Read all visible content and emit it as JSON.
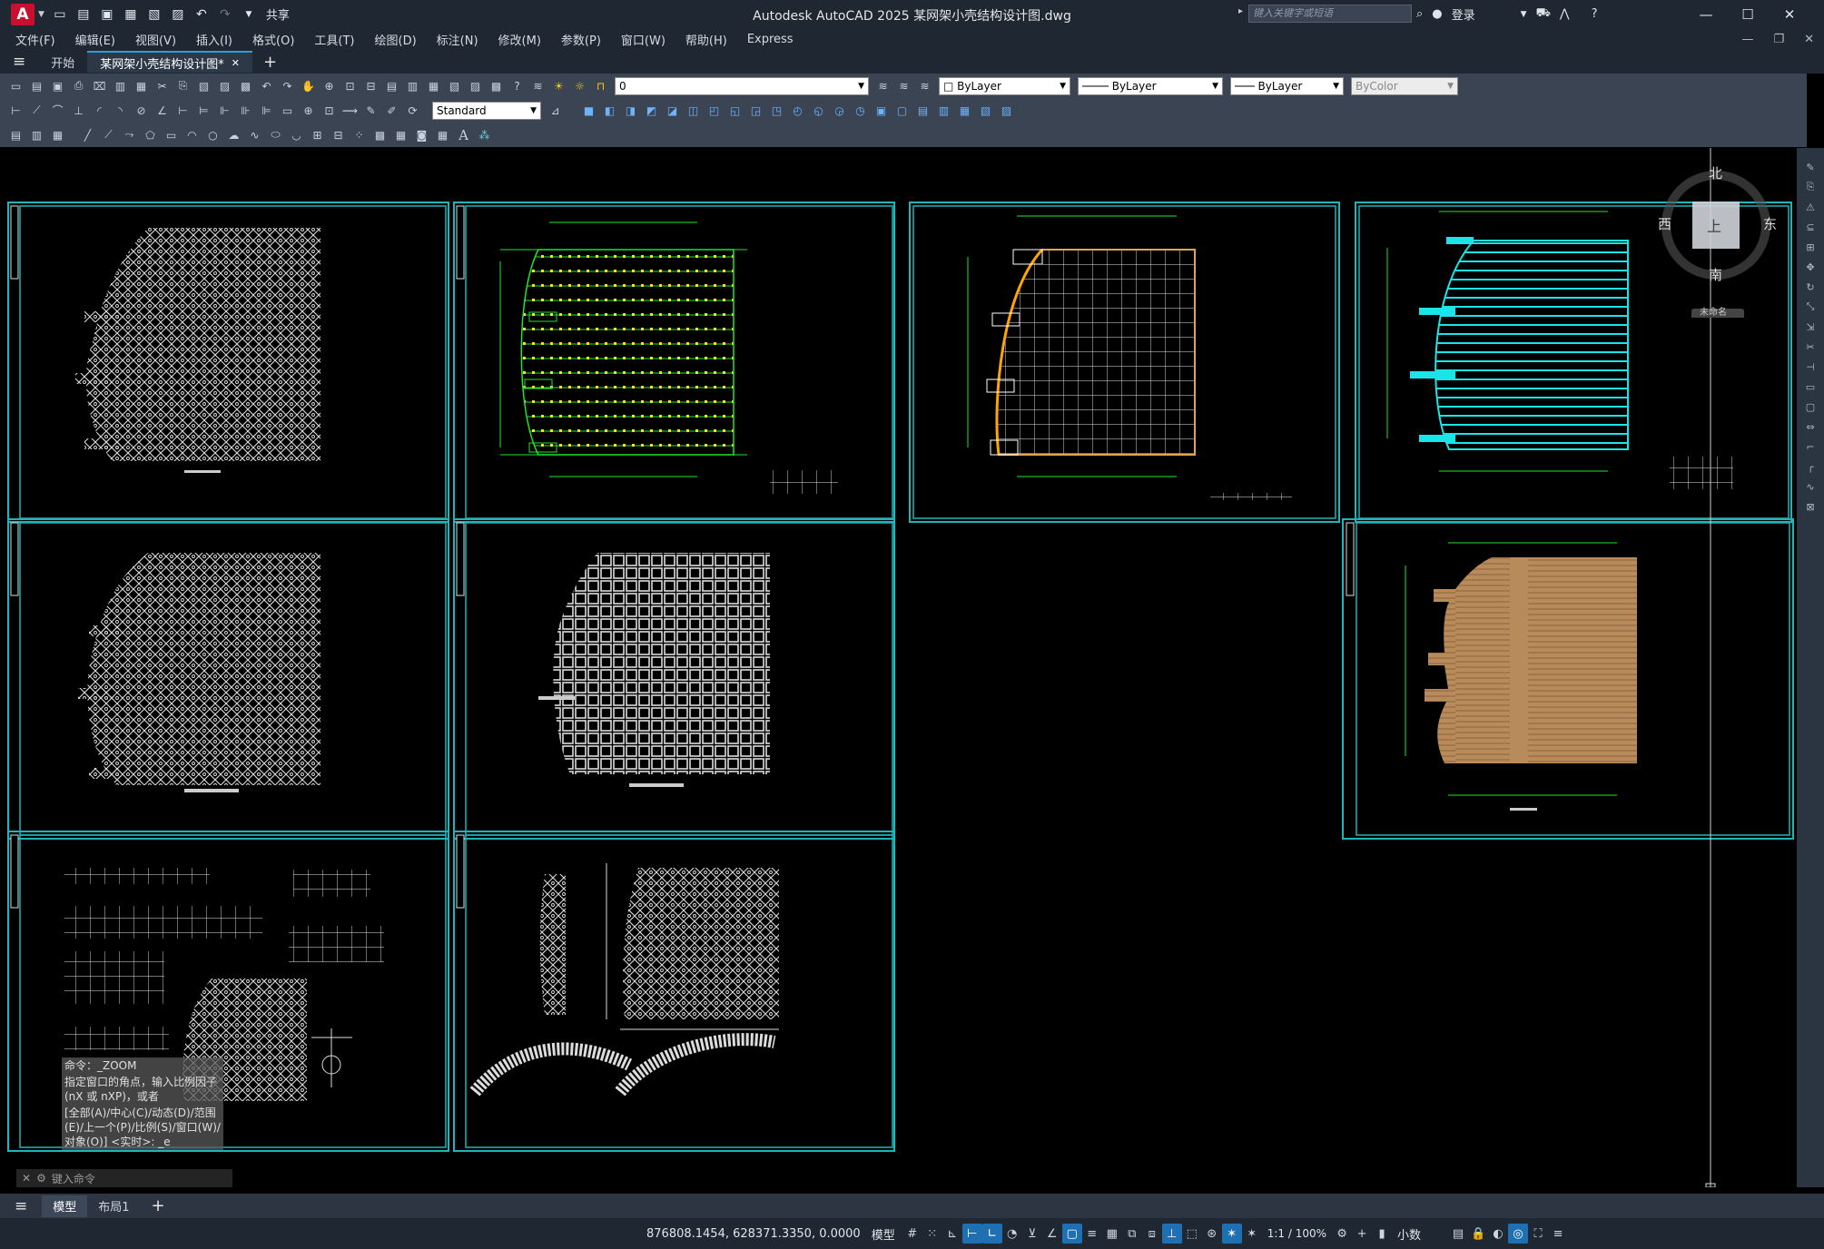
{
  "app": {
    "logo_letter": "A",
    "title": "Autodesk AutoCAD 2025    某网架小壳结构设计图.dwg",
    "share": "共享",
    "search_placeholder": "键入关键字或短语",
    "login": "登录"
  },
  "menu": [
    "文件(F)",
    "编辑(E)",
    "视图(V)",
    "插入(I)",
    "格式(O)",
    "工具(T)",
    "绘图(D)",
    "标注(N)",
    "修改(M)",
    "参数(P)",
    "窗口(W)",
    "帮助(H)",
    "Express"
  ],
  "tabs": {
    "start": "开始",
    "doc": "某网架小壳结构设计图*",
    "add": "+"
  },
  "toolbar": {
    "layer": "0",
    "color": "ByLayer",
    "linetype": "ByLayer",
    "lineweight": "ByLayer",
    "plotstyle": "ByColor",
    "textstyle": "Standard"
  },
  "viewcube": {
    "north": "北",
    "south": "南",
    "east": "东",
    "west": "西",
    "top": "上",
    "wcs": "未命名"
  },
  "command": {
    "history": [
      "命令：_ZOOM",
      "指定窗口的角点，输入比例因子 (nX 或 nXP)，或者",
      "[全部(A)/中心(C)/动态(D)/范围(E)/上一个(P)/比例(S)/窗口(W)/对象(O)] <实时>: _e"
    ],
    "prompt": "键入命令"
  },
  "layout_tabs": [
    "模型",
    "布局1"
  ],
  "status": {
    "coords": "876808.1454, 628371.3350, 0.0000",
    "model": "模型",
    "scale": "1:1 / 100%",
    "units": "小数"
  },
  "colors": {
    "frame": "#1fb5b8",
    "accent": "#1f6fb3"
  }
}
